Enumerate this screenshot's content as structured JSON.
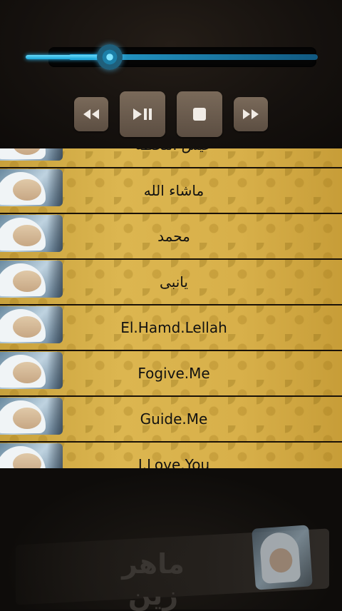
{
  "player": {
    "progress": 0.29,
    "buttons": [
      {
        "name": "rewind-button",
        "icon": "rewind-icon"
      },
      {
        "name": "play-pause-button",
        "icon": "play-pause-icon"
      },
      {
        "name": "stop-button",
        "icon": "stop-icon"
      },
      {
        "name": "fast-forward-button",
        "icon": "fast-forward-icon"
      }
    ]
  },
  "playlist": {
    "items": [
      {
        "title": "عيش اللحظة"
      },
      {
        "title": "ماشاء الله"
      },
      {
        "title": "محمد"
      },
      {
        "title": "يانبى"
      },
      {
        "title": "El.Hamd.Lellah"
      },
      {
        "title": "Fogive.Me"
      },
      {
        "title": "Guide.Me"
      },
      {
        "title": "I.Love.You"
      }
    ]
  },
  "banner": {
    "text": "ماهر زين"
  },
  "colors": {
    "accent": "#1aa6d8",
    "button": "#6b5c4e",
    "row": "#d4ac46"
  }
}
